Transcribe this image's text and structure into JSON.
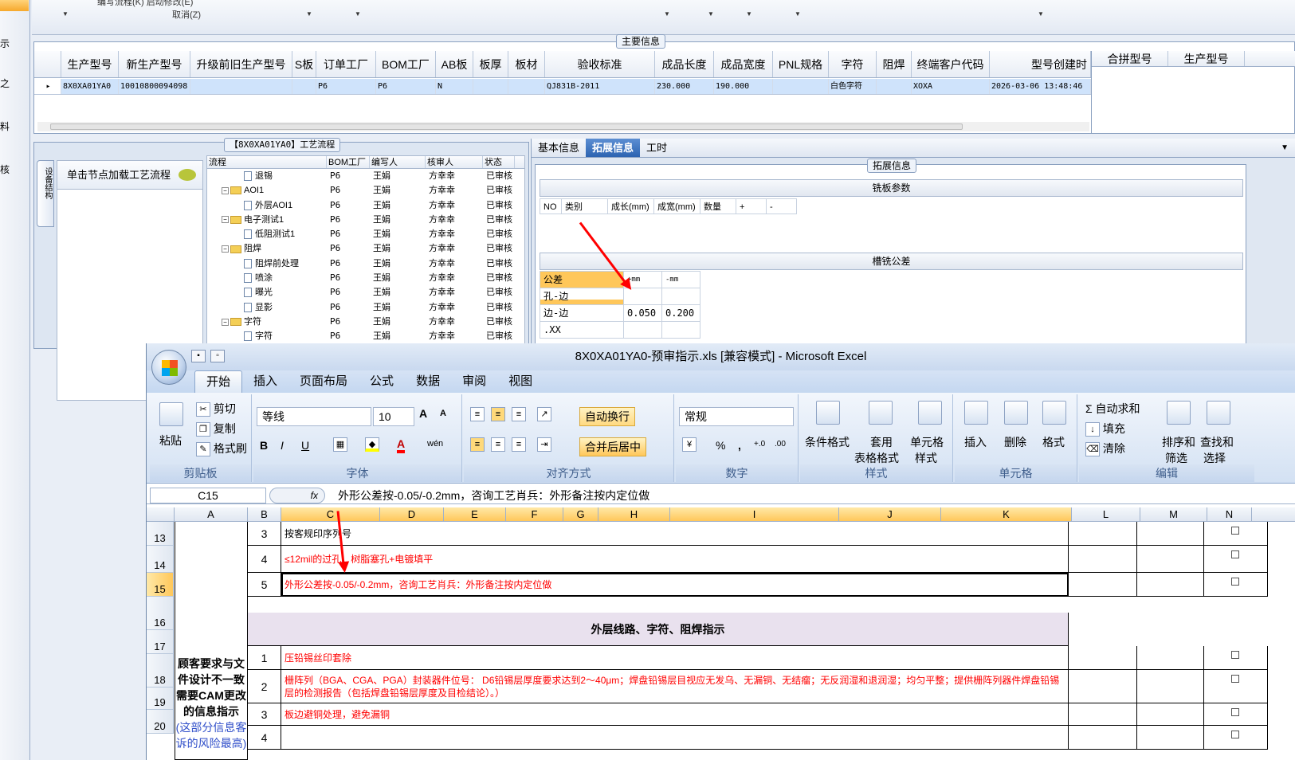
{
  "left_strip": {
    "items": [
      "示",
      "之",
      "料",
      "核"
    ]
  },
  "toolbar": {
    "line1": "编写流程(K)    启动修改(E)",
    "line2": "取消(Z)"
  },
  "main_info": {
    "title": "主要信息",
    "columns": [
      "生产型号",
      "新生产型号",
      "升级前旧生产型号",
      "S板",
      "订单工厂",
      "BOM工厂",
      "AB板",
      "板厚",
      "板材",
      "验收标准",
      "成品长度",
      "成品宽度",
      "PNL规格",
      "字符",
      "阻焊",
      "终端客户代码",
      "型号创建时"
    ],
    "row": [
      "8X0XA01YA0",
      "10010800094098",
      "",
      "",
      "P6",
      "P6",
      "N",
      "",
      "",
      "QJ831B-2011",
      "230.000",
      "190.000",
      "",
      "白色字符",
      "",
      "XOXA",
      "2026-03-06 13:48:46"
    ],
    "right_columns": [
      "合拼型号",
      "生产型号"
    ],
    "row_marker": "▸"
  },
  "process": {
    "title": "【8X0XA01YA0】工艺流程",
    "side_tab": "设备结构",
    "node_label": "单击节点加载工艺流程",
    "headers": [
      "流程",
      "BOM工厂",
      "编写人",
      "核审人",
      "状态"
    ],
    "rows": [
      {
        "indent": 2,
        "kind": "doc",
        "name": "退锡",
        "bom": "P6",
        "writer": "王娟",
        "reviewer": "方幸幸",
        "status": "已审核"
      },
      {
        "indent": 1,
        "kind": "folder",
        "name": "AOI1",
        "bom": "P6",
        "writer": "王娟",
        "reviewer": "方幸幸",
        "status": "已审核"
      },
      {
        "indent": 2,
        "kind": "doc",
        "name": "外层AOI1",
        "bom": "P6",
        "writer": "王娟",
        "reviewer": "方幸幸",
        "status": "已审核"
      },
      {
        "indent": 1,
        "kind": "folder",
        "name": "电子测试1",
        "bom": "P6",
        "writer": "王娟",
        "reviewer": "方幸幸",
        "status": "已审核"
      },
      {
        "indent": 2,
        "kind": "doc",
        "name": "低阻测试1",
        "bom": "P6",
        "writer": "王娟",
        "reviewer": "方幸幸",
        "status": "已审核"
      },
      {
        "indent": 1,
        "kind": "folder",
        "name": "阻焊",
        "bom": "P6",
        "writer": "王娟",
        "reviewer": "方幸幸",
        "status": "已审核"
      },
      {
        "indent": 2,
        "kind": "doc",
        "name": "阻焊前处理",
        "bom": "P6",
        "writer": "王娟",
        "reviewer": "方幸幸",
        "status": "已审核"
      },
      {
        "indent": 2,
        "kind": "doc",
        "name": "喷涂",
        "bom": "P6",
        "writer": "王娟",
        "reviewer": "方幸幸",
        "status": "已审核"
      },
      {
        "indent": 2,
        "kind": "doc",
        "name": "曝光",
        "bom": "P6",
        "writer": "王娟",
        "reviewer": "方幸幸",
        "status": "已审核"
      },
      {
        "indent": 2,
        "kind": "doc",
        "name": "显影",
        "bom": "P6",
        "writer": "王娟",
        "reviewer": "方幸幸",
        "status": "已审核"
      },
      {
        "indent": 1,
        "kind": "folder",
        "name": "字符",
        "bom": "P6",
        "writer": "王娟",
        "reviewer": "方幸幸",
        "status": "已审核"
      },
      {
        "indent": 2,
        "kind": "doc",
        "name": "字符",
        "bom": "P6",
        "writer": "王娟",
        "reviewer": "方幸幸",
        "status": "已审核"
      }
    ]
  },
  "ext": {
    "tabs": [
      "基本信息",
      "拓展信息",
      "工时"
    ],
    "active_tab": 1,
    "box_title": "拓展信息",
    "milling_title": "铣板参数",
    "milling_headers": [
      "NO",
      "类别",
      "成长(mm)",
      "成宽(mm)",
      "数量",
      "+",
      "-"
    ],
    "slot_title": "槽铣公差",
    "tolerance": [
      [
        "公差",
        "+mm",
        "-mm"
      ],
      [
        "孔-边",
        "",
        ""
      ],
      [
        "边-边",
        "0.050",
        "0.200"
      ],
      [
        ".XX",
        "",
        ""
      ]
    ]
  },
  "excel": {
    "title": "8X0XA01YA0-预审指示.xls  [兼容模式] - Microsoft Excel",
    "tabs": [
      "开始",
      "插入",
      "页面布局",
      "公式",
      "数据",
      "审阅",
      "视图"
    ],
    "clipboard": {
      "paste": "粘贴",
      "cut": "剪切",
      "copy": "复制",
      "painter": "格式刷",
      "name": "剪贴板"
    },
    "font": {
      "family": "等线",
      "size": "10",
      "grow": "A",
      "shrink": "A",
      "bold": "B",
      "italic": "I",
      "underline": "U",
      "color": "A",
      "phonetic": "wén",
      "name": "字体"
    },
    "align": {
      "wrap": "自动换行",
      "merge": "合并后居中",
      "name": "对齐方式"
    },
    "number": {
      "format": "常规",
      "percent": "%",
      "comma": ",",
      "inc": "+.0",
      "dec": ".00",
      "name": "数字"
    },
    "styles": {
      "cond": "条件格式",
      "table1": "套用",
      "table2": "表格格式",
      "cell1": "单元格",
      "cell2": "样式",
      "name": "样式"
    },
    "cells": {
      "insert": "插入",
      "delete": "删除",
      "format": "格式",
      "name": "单元格"
    },
    "editing": {
      "autosum": "自动求和",
      "fill": "填充",
      "clear": "清除",
      "sort1": "排序和",
      "sort2": "筛选",
      "find1": "查找和",
      "find2": "选择",
      "name": "编辑"
    },
    "name_box": "C15",
    "fx": "fx",
    "formula": "外形公差按-0.05/-0.2mm，咨询工艺肖兵：外形备注按内定位做",
    "columns": [
      "A",
      "B",
      "C",
      "D",
      "E",
      "F",
      "G",
      "H",
      "I",
      "J",
      "K",
      "L",
      "M",
      "N"
    ],
    "rows": [
      "13",
      "14",
      "15",
      "16",
      "17",
      "18",
      "19",
      "20"
    ],
    "group_label": "顾客要求与文件设计不一致需要CAM更改的信息指示",
    "group_note": "(这部分信息客诉的风险最高)",
    "section_header": "外层线路、字符、阻焊指示",
    "items": [
      {
        "no": "3",
        "text": "按客规印序列号"
      },
      {
        "no": "4",
        "text": "≤12mil的过孔，树脂塞孔+电镀填平"
      },
      {
        "no": "5",
        "text": "外形公差按-0.05/-0.2mm，咨询工艺肖兵：外形备注按内定位做"
      },
      {
        "no": "1",
        "text": "压铅锡丝印套除"
      },
      {
        "no": "2",
        "text": "栅阵列（BGA、CGA、PGA）封装器件位号： D6铅锡层厚度要求达到2～40μm；焊盘铅锡层目视应无发乌、无漏铜、无结瘤；无反润湿和退润湿；均匀平整；提供栅阵列器件焊盘铅锡层的检测报告（包括焊盘铅锡层厚度及目检结论）。）"
      },
      {
        "no": "3",
        "text": "板边避铜处理，避免漏铜"
      },
      {
        "no": "4",
        "text": ""
      }
    ]
  },
  "colors": {
    "accent": "#2d63b1",
    "selection": "#cfe3fb",
    "excel_red": "#ff0000",
    "header_orange": "#ffc75a"
  }
}
